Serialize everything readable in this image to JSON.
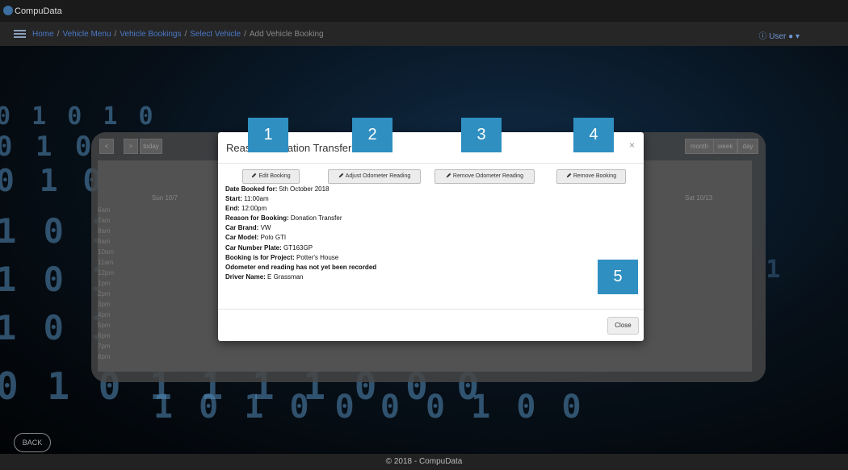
{
  "app": {
    "brand": "CompuData"
  },
  "breadcrumbs": [
    "Home",
    "Vehicle Menu",
    "Vehicle Bookings",
    "Select Vehicle",
    "Add Vehicle Booking"
  ],
  "user_menu": "User",
  "calendar": {
    "nav_prev": "<",
    "nav_next": ">",
    "today": "today",
    "views": [
      "month",
      "week",
      "day"
    ],
    "columns": [
      "Sun 10/7",
      "Sat 10/13"
    ],
    "hours": [
      "6am",
      "7am",
      "8am",
      "9am",
      "10am",
      "11am",
      "12pm",
      "1pm",
      "2pm",
      "3pm",
      "4pm",
      "5pm",
      "6pm",
      "7pm",
      "8pm"
    ]
  },
  "modal": {
    "title": "Reason: Donation Transfer",
    "close_x": "×",
    "buttons": [
      "Edit Booking",
      "Adjust Odometer Reading",
      "Remove Odometer Reading",
      "Remove Booking"
    ],
    "details": [
      {
        "label": "Date Booked for:",
        "value": "5th October 2018"
      },
      {
        "label": "Start:",
        "value": "11:00am"
      },
      {
        "label": "End:",
        "value": "12:00pm"
      },
      {
        "label": "Reason for Booking:",
        "value": "Donation Transfer"
      },
      {
        "label": "Car Brand:",
        "value": "VW"
      },
      {
        "label": "Car Model:",
        "value": "Polo GTI"
      },
      {
        "label": "Car Number Plate:",
        "value": "GT163GP"
      },
      {
        "label": "Booking is for Project:",
        "value": "Potter's House"
      },
      {
        "label": "Odometer end reading has not yet been recorded",
        "value": ""
      },
      {
        "label": "Driver Name:",
        "value": "E Grassman"
      }
    ],
    "close_button": "Close"
  },
  "callouts": [
    "1",
    "2",
    "3",
    "4",
    "5"
  ],
  "back_button": "BACK",
  "footer": "© 2018 - CompuData"
}
